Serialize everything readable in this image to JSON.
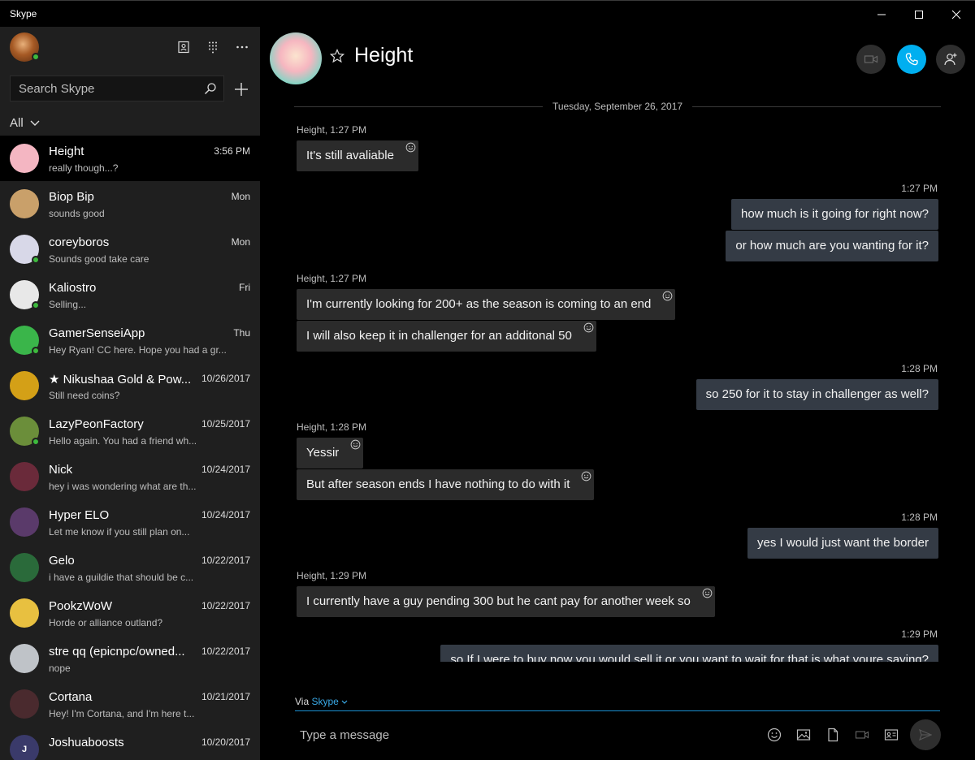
{
  "window": {
    "title": "Skype"
  },
  "sidebar": {
    "search_placeholder": "Search Skype",
    "filter_label": "All",
    "contacts": [
      {
        "name": "Height",
        "time": "3:56 PM",
        "preview": "really though...?",
        "online": false,
        "active": true,
        "avatar_color": "#f4b6c2"
      },
      {
        "name": "Biop Bip",
        "time": "Mon",
        "preview": "sounds good",
        "online": false,
        "active": false,
        "avatar_color": "#c9a06a"
      },
      {
        "name": "coreyboros",
        "time": "Mon",
        "preview": "Sounds good take care",
        "online": true,
        "active": false,
        "avatar_color": "#d8d8e8"
      },
      {
        "name": "Kaliostro",
        "time": "Fri",
        "preview": "Selling...",
        "online": true,
        "active": false,
        "avatar_color": "#e8e8e8"
      },
      {
        "name": "GamerSenseiApp",
        "time": "Thu",
        "preview": "Hey Ryan!  CC here. Hope you had a gr...",
        "online": true,
        "active": false,
        "avatar_color": "#3ab54a"
      },
      {
        "name": "★ Nikushaa Gold & Pow...",
        "time": "10/26/2017",
        "preview": "Still need coins?",
        "online": false,
        "active": false,
        "avatar_color": "#d4a017"
      },
      {
        "name": "LazyPeonFactory",
        "time": "10/25/2017",
        "preview": "Hello again. You had a friend wh...",
        "online": true,
        "active": false,
        "avatar_color": "#6b8e3a"
      },
      {
        "name": "Nick",
        "time": "10/24/2017",
        "preview": "hey i was wondering what are th...",
        "online": false,
        "active": false,
        "avatar_color": "#6a2a3a"
      },
      {
        "name": "Hyper ELO",
        "time": "10/24/2017",
        "preview": "Let me know if you still plan on...",
        "online": false,
        "active": false,
        "avatar_color": "#5a3a6a"
      },
      {
        "name": "Gelo",
        "time": "10/22/2017",
        "preview": "i have a guildie that should be c...",
        "online": false,
        "active": false,
        "avatar_color": "#2a6a3a"
      },
      {
        "name": "PookzWoW",
        "time": "10/22/2017",
        "preview": "Horde or alliance outland?",
        "online": false,
        "active": false,
        "avatar_color": "#e8c040"
      },
      {
        "name": "stre qq  (epicnpc/owned...",
        "time": "10/22/2017",
        "preview": "nope",
        "online": false,
        "active": false,
        "avatar_color": "#bfc3c8"
      },
      {
        "name": "Cortana",
        "time": "10/21/2017",
        "preview": "Hey! I'm Cortana, and I'm here t...",
        "online": false,
        "active": false,
        "avatar_color": "#4a2a2e"
      },
      {
        "name": "Joshuaboosts",
        "time": "10/20/2017",
        "preview": "",
        "online": false,
        "active": false,
        "avatar_color": "#3a3a6a",
        "avatar_initial": "J"
      }
    ]
  },
  "chat": {
    "title": "Height",
    "date_divider": "Tuesday, September 26, 2017",
    "messages": [
      {
        "kind": "sender",
        "text": "Height,  1:27 PM"
      },
      {
        "kind": "in",
        "text": "It's still avaliable"
      },
      {
        "kind": "time",
        "text": "1:27 PM"
      },
      {
        "kind": "out",
        "text": "how much is it going for right now?"
      },
      {
        "kind": "out",
        "text": "or how much are you wanting for it?"
      },
      {
        "kind": "sender",
        "text": "Height,  1:27 PM"
      },
      {
        "kind": "in",
        "text": "I'm currently looking for 200+ as the season is coming to an end"
      },
      {
        "kind": "in",
        "text": "I will also keep it in challenger for an additonal 50"
      },
      {
        "kind": "time",
        "text": "1:28 PM"
      },
      {
        "kind": "out",
        "text": "so 250 for it to stay in challenger as well?"
      },
      {
        "kind": "sender",
        "text": "Height,  1:28 PM"
      },
      {
        "kind": "in",
        "text": "Yessir"
      },
      {
        "kind": "in",
        "text": "But after season ends I have nothing to do with it"
      },
      {
        "kind": "time",
        "text": "1:28 PM"
      },
      {
        "kind": "out",
        "text": "yes I would just want the border"
      },
      {
        "kind": "sender",
        "text": "Height,  1:29 PM"
      },
      {
        "kind": "in",
        "text": "I currently have a guy pending 300 but he cant pay for another week so"
      },
      {
        "kind": "time",
        "text": "1:29 PM"
      },
      {
        "kind": "out",
        "text": "so If I were to buy now you would sell it or you want to wait for that is what youre saying?"
      }
    ],
    "via_prefix": "Via",
    "via_link": "Skype",
    "compose_placeholder": "Type a message"
  },
  "colors": {
    "accent": "#00aff0",
    "online": "#3dba3d",
    "incoming_bubble": "#2b2b2b",
    "outgoing_bubble": "#343b45"
  }
}
